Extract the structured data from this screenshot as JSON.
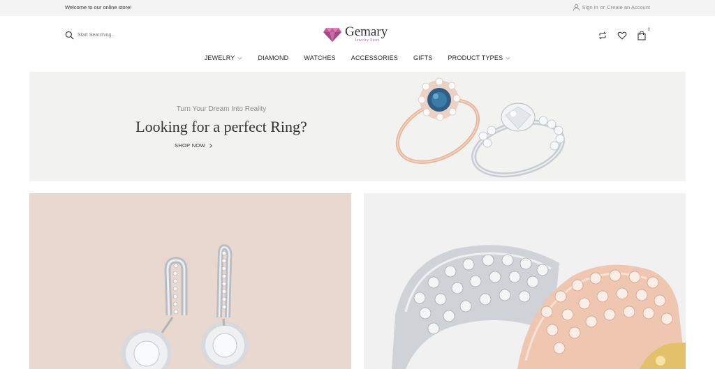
{
  "topbar": {
    "welcome": "Welcome to our online store!",
    "sign_in": "Sign in",
    "or": "or",
    "create_account": "Create an Account"
  },
  "search": {
    "placeholder": "Start Searching..."
  },
  "logo": {
    "name": "Gemary",
    "tagline": "Jewelry Store",
    "color": "#c05a9b"
  },
  "header_icons": {
    "cart_count": "0",
    "icons": [
      "compare-icon",
      "heart-icon",
      "cart-icon"
    ]
  },
  "nav": {
    "items": [
      {
        "label": "JEWELRY",
        "dropdown": true
      },
      {
        "label": "DIAMOND",
        "dropdown": false
      },
      {
        "label": "WATCHES",
        "dropdown": false
      },
      {
        "label": "ACCESSORIES",
        "dropdown": false
      },
      {
        "label": "GIFTS",
        "dropdown": false
      },
      {
        "label": "PRODUCT TYPES",
        "dropdown": true
      }
    ]
  },
  "hero": {
    "subtitle": "Turn Your Dream Into Reality",
    "title": "Looking for a perfect Ring?",
    "cta": "SHOP NOW"
  },
  "colors": {
    "topbar_bg": "#f4f4f4",
    "hero_bg": "#f2f2f0",
    "card_left_bg": "#e9d8cf",
    "card_right_bg": "#f1f1f1",
    "rose_gold": "#e8b79c"
  }
}
